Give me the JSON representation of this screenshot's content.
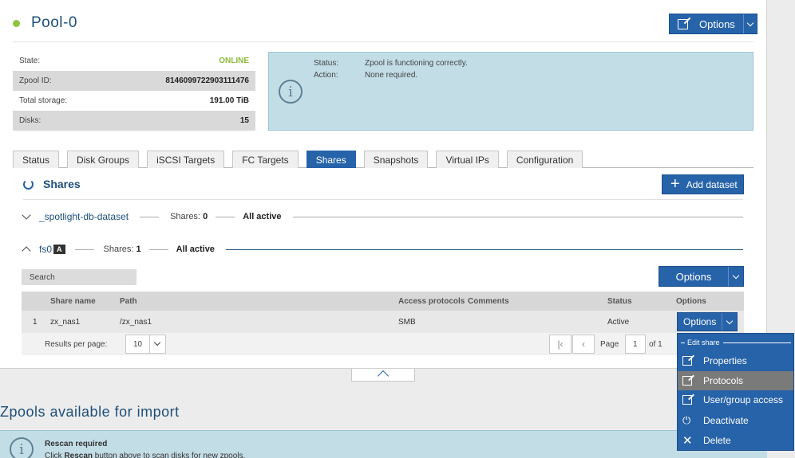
{
  "pool": {
    "name": "Pool-0",
    "options_label": "Options",
    "status_color": "#8cc63f"
  },
  "info": {
    "state_label": "State:",
    "state_value": "ONLINE",
    "zpool_id_label": "Zpool ID:",
    "zpool_id_value": "8146099722903111476",
    "total_storage_label": "Total storage:",
    "total_storage_value": "191.00 TiB",
    "disks_label": "Disks:",
    "disks_value": "15"
  },
  "status_box": {
    "status_label": "Status:",
    "status_value": "Zpool is functioning correctly.",
    "action_label": "Action:",
    "action_value": "None required."
  },
  "tabs": [
    {
      "label": "Status"
    },
    {
      "label": "Disk Groups"
    },
    {
      "label": "iSCSI Targets"
    },
    {
      "label": "FC Targets"
    },
    {
      "label": "Shares",
      "active": true
    },
    {
      "label": "Snapshots"
    },
    {
      "label": "Virtual IPs"
    },
    {
      "label": "Configuration"
    }
  ],
  "shares": {
    "title": "Shares",
    "add_dataset_label": "Add dataset",
    "datasets": [
      {
        "name": "_spotlight-db-dataset",
        "shares_label": "Shares:",
        "shares_count": "0",
        "status": "All active",
        "expanded": false
      },
      {
        "name": "fs0",
        "badge": "A",
        "shares_label": "Shares:",
        "shares_count": "1",
        "status": "All active",
        "expanded": true
      }
    ],
    "options_label": "Options",
    "search_placeholder": "Search",
    "columns": [
      "Share name",
      "Path",
      "Access protocols",
      "Comments",
      "Status",
      "Options"
    ],
    "rows": [
      {
        "index": "1",
        "share_name": "zx_nas1",
        "path": "/zx_nas1",
        "access_protocols": "SMB",
        "comments": "",
        "status": "Active",
        "options_label": "Options"
      }
    ],
    "pager": {
      "results_per_page_label": "Results per page:",
      "per_page_value": "10",
      "page_label": "Page",
      "page_value": "1",
      "of_label": "of 1"
    }
  },
  "dropdown": {
    "header": "Edit share",
    "items": [
      {
        "label": "Properties",
        "icon": "edit-icon"
      },
      {
        "label": "Protocols",
        "icon": "edit-icon",
        "hover": true
      },
      {
        "label": "User/group access",
        "icon": "edit-icon"
      },
      {
        "label": "Deactivate",
        "icon": "plug-icon"
      },
      {
        "label": "Delete",
        "icon": "close-icon"
      }
    ]
  },
  "import": {
    "title": "Zpools available for import",
    "rescan_title": "Rescan required",
    "rescan_text_before": "Click ",
    "rescan_text_bold": "Rescan",
    "rescan_text_after": " button above to scan disks for new zpools."
  }
}
